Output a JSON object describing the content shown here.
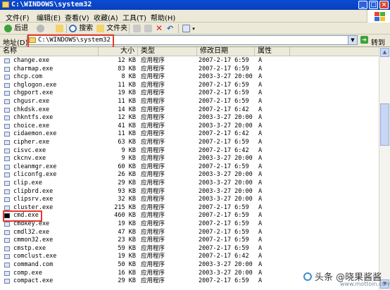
{
  "window": {
    "title": "C:\\WINDOWS\\system32",
    "min_label": "_",
    "max_label": "□",
    "close_label": "×"
  },
  "menu": [
    "文件(F)",
    "编辑(E)",
    "查看(V)",
    "收藏(A)",
    "工具(T)",
    "帮助(H)"
  ],
  "toolbar": {
    "back_label": "后退",
    "search_label": "搜索",
    "folders_label": "文件夹"
  },
  "address": {
    "label": "地址(D)",
    "value": "C:\\WINDOWS\\system32",
    "go_label": "转到"
  },
  "columns": {
    "name": "名称",
    "size": "大小",
    "type": "类型",
    "date": "修改日期",
    "attr": "属性"
  },
  "files": [
    {
      "name": "change.exe",
      "size": "12 KB",
      "type": "应用程序",
      "date": "2007-2-17 6:59",
      "attr": "A"
    },
    {
      "name": "charmap.exe",
      "size": "83 KB",
      "type": "应用程序",
      "date": "2007-2-17 6:59",
      "attr": "A"
    },
    {
      "name": "chcp.com",
      "size": "8 KB",
      "type": "应用程序",
      "date": "2003-3-27 20:00",
      "attr": "A"
    },
    {
      "name": "chglogon.exe",
      "size": "11 KB",
      "type": "应用程序",
      "date": "2007-2-17 6:59",
      "attr": "A"
    },
    {
      "name": "chgport.exe",
      "size": "19 KB",
      "type": "应用程序",
      "date": "2007-2-17 6:59",
      "attr": "A"
    },
    {
      "name": "chgusr.exe",
      "size": "11 KB",
      "type": "应用程序",
      "date": "2007-2-17 6:59",
      "attr": "A"
    },
    {
      "name": "chkdsk.exe",
      "size": "14 KB",
      "type": "应用程序",
      "date": "2007-2-17 6:42",
      "attr": "A"
    },
    {
      "name": "chkntfs.exe",
      "size": "12 KB",
      "type": "应用程序",
      "date": "2003-3-27 20:00",
      "attr": "A"
    },
    {
      "name": "choice.exe",
      "size": "41 KB",
      "type": "应用程序",
      "date": "2003-3-27 20:00",
      "attr": "A"
    },
    {
      "name": "cidaemon.exe",
      "size": "11 KB",
      "type": "应用程序",
      "date": "2007-2-17 6:42",
      "attr": "A"
    },
    {
      "name": "cipher.exe",
      "size": "63 KB",
      "type": "应用程序",
      "date": "2007-2-17 6:59",
      "attr": "A"
    },
    {
      "name": "cisvc.exe",
      "size": "9 KB",
      "type": "应用程序",
      "date": "2007-2-17 6:42",
      "attr": "A"
    },
    {
      "name": "ckcnv.exe",
      "size": "9 KB",
      "type": "应用程序",
      "date": "2003-3-27 20:00",
      "attr": "A"
    },
    {
      "name": "cleanmgr.exe",
      "size": "60 KB",
      "type": "应用程序",
      "date": "2007-2-17 6:59",
      "attr": "A"
    },
    {
      "name": "cliconfg.exe",
      "size": "26 KB",
      "type": "应用程序",
      "date": "2003-3-27 20:00",
      "attr": "A"
    },
    {
      "name": "clip.exe",
      "size": "29 KB",
      "type": "应用程序",
      "date": "2003-3-27 20:00",
      "attr": "A"
    },
    {
      "name": "clipbrd.exe",
      "size": "93 KB",
      "type": "应用程序",
      "date": "2003-3-27 20:00",
      "attr": "A"
    },
    {
      "name": "clipsrv.exe",
      "size": "32 KB",
      "type": "应用程序",
      "date": "2003-3-27 20:00",
      "attr": "A"
    },
    {
      "name": "cluster.exe",
      "size": "215 KB",
      "type": "应用程序",
      "date": "2007-2-17 6:59",
      "attr": "A"
    },
    {
      "name": "cmd.exe",
      "size": "460 KB",
      "type": "应用程序",
      "date": "2007-2-17 6:59",
      "attr": "A"
    },
    {
      "name": "cmdkey.exe",
      "size": "19 KB",
      "type": "应用程序",
      "date": "2007-2-17 6:59",
      "attr": "A"
    },
    {
      "name": "cmdl32.exe",
      "size": "47 KB",
      "type": "应用程序",
      "date": "2007-2-17 6:59",
      "attr": "A"
    },
    {
      "name": "cmmon32.exe",
      "size": "23 KB",
      "type": "应用程序",
      "date": "2007-2-17 6:59",
      "attr": "A"
    },
    {
      "name": "cmstp.exe",
      "size": "59 KB",
      "type": "应用程序",
      "date": "2007-2-17 6:59",
      "attr": "A"
    },
    {
      "name": "comclust.exe",
      "size": "19 KB",
      "type": "应用程序",
      "date": "2007-2-17 6:42",
      "attr": "A"
    },
    {
      "name": "command.com",
      "size": "50 KB",
      "type": "应用程序",
      "date": "2003-3-27 20:00",
      "attr": "A"
    },
    {
      "name": "comp.exe",
      "size": "16 KB",
      "type": "应用程序",
      "date": "2003-3-27 20:00",
      "attr": "A"
    },
    {
      "name": "compact.exe",
      "size": "29 KB",
      "type": "应用程序",
      "date": "2007-2-17 6:59",
      "attr": "A"
    }
  ],
  "watermark": {
    "text": "头条 @晓果酱酱",
    "url": "www.mottoin.com"
  },
  "colors": {
    "title_bar": "#0a4bd6",
    "highlight_box": "#e8392e",
    "chrome": "#ece9d8"
  }
}
